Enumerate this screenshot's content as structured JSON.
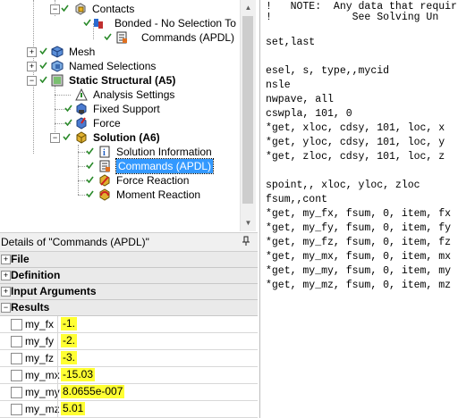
{
  "tree": {
    "items": [
      {
        "label": "Contacts"
      },
      {
        "label": "Bonded - No Selection To No"
      },
      {
        "label": "Commands (APDL)"
      },
      {
        "label": "Mesh"
      },
      {
        "label": "Named Selections"
      },
      {
        "label": "Static Structural (A5)"
      },
      {
        "label": "Analysis Settings"
      },
      {
        "label": "Fixed Support"
      },
      {
        "label": "Force"
      },
      {
        "label": "Solution (A6)"
      },
      {
        "label": "Solution Information"
      },
      {
        "label": "Commands (APDL)"
      },
      {
        "label": "Force Reaction"
      },
      {
        "label": "Moment Reaction"
      }
    ]
  },
  "details": {
    "title": "Details of \"Commands (APDL)\"",
    "groups": {
      "file": "File",
      "definition": "Definition",
      "input_arguments": "Input Arguments",
      "results": "Results"
    },
    "results": [
      {
        "name": "my_fx",
        "value": "-1."
      },
      {
        "name": "my_fy",
        "value": "-2."
      },
      {
        "name": "my_fz",
        "value": "-3."
      },
      {
        "name": "my_mx",
        "value": "-15.03"
      },
      {
        "name": "my_my",
        "value": "8.0655e-007"
      },
      {
        "name": "my_mz",
        "value": "5.01"
      }
    ]
  },
  "editor": {
    "lines": [
      "!   NOTE:  Any data that requir",
      "!             See Solving Un",
      "",
      "set,last",
      "",
      "esel, s, type,,mycid",
      "nsle",
      "nwpave, all",
      "cswpla, 101, 0",
      "*get, xloc, cdsy, 101, loc, x",
      "*get, yloc, cdsy, 101, loc, y",
      "*get, zloc, cdsy, 101, loc, z",
      "",
      "spoint,, xloc, yloc, zloc",
      "fsum,,cont",
      "*get, my_fx, fsum, 0, item, fx",
      "*get, my_fy, fsum, 0, item, fy",
      "*get, my_fz, fsum, 0, item, fz",
      "*get, my_mx, fsum, 0, item, mx",
      "*get, my_my, fsum, 0, item, my",
      "*get, my_mz, fsum, 0, item, mz"
    ]
  }
}
